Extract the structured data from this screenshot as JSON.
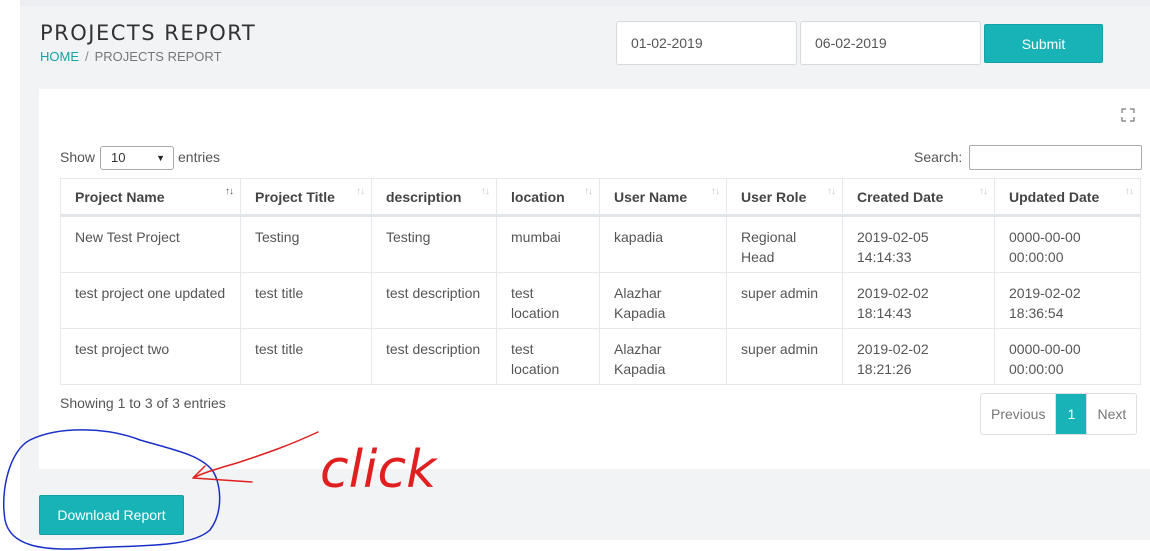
{
  "header": {
    "title": "PROJECTS REPORT",
    "breadcrumb_home": "HOME",
    "breadcrumb_sep": "/",
    "breadcrumb_current": "PROJECTS REPORT"
  },
  "filters": {
    "date_from": "01-02-2019",
    "date_to": "06-02-2019",
    "submit_label": "Submit"
  },
  "table_controls": {
    "show_label": "Show",
    "entries_value": "10",
    "entries_label": "entries",
    "search_label": "Search:",
    "search_value": ""
  },
  "table": {
    "columns": [
      "Project Name",
      "Project Title",
      "description",
      "location",
      "User Name",
      "User Role",
      "Created Date",
      "Updated Date"
    ],
    "rows": [
      [
        "New Test Project",
        "Testing",
        "Testing",
        "mumbai",
        "kapadia",
        "Regional Head",
        "2019-02-05 14:14:33",
        "0000-00-00 00:00:00"
      ],
      [
        "test project one updated",
        "test title",
        "test description",
        "test location",
        "Alazhar Kapadia",
        "super admin",
        "2019-02-02 18:14:43",
        "2019-02-02 18:36:54"
      ],
      [
        "test project two",
        "test title",
        "test description",
        "test location",
        "Alazhar Kapadia",
        "super admin",
        "2019-02-02 18:21:26",
        "0000-00-00 00:00:00"
      ]
    ]
  },
  "footer": {
    "info": "Showing 1 to 3 of 3 entries",
    "prev_label": "Previous",
    "current_page": "1",
    "next_label": "Next"
  },
  "actions": {
    "download_label": "Download Report"
  },
  "annotation": {
    "text": "click"
  },
  "colors": {
    "accent": "#17b3b7",
    "annotation_red": "#e02020",
    "annotation_blue": "#1a2fc8"
  }
}
